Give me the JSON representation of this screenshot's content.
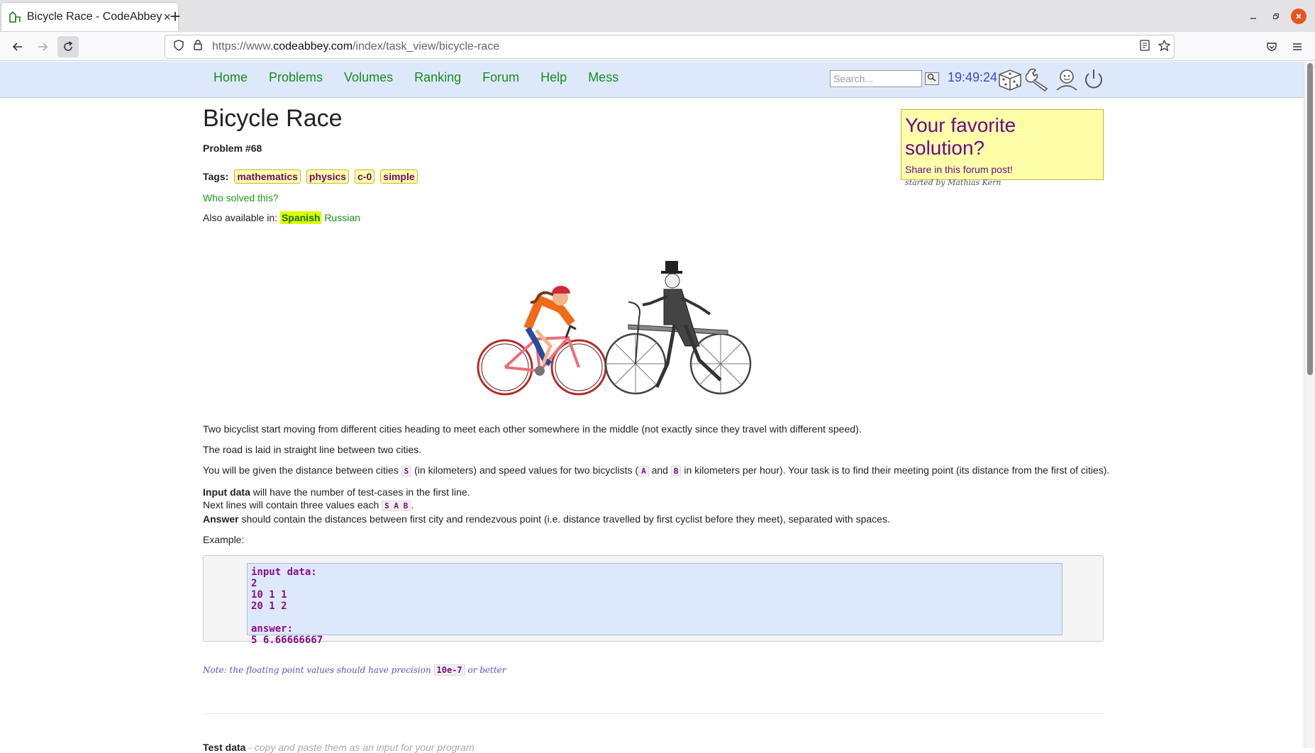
{
  "browser": {
    "tab_title": "Bicycle Race - CodeAbbey",
    "tab_close": "×",
    "new_tab": "+",
    "url_host_prefix": "https://www.",
    "url_host": "codeabbey.com",
    "url_path": "/index/task_view/bicycle-race"
  },
  "site": {
    "nav": [
      "Home",
      "Problems",
      "Volumes",
      "Ranking",
      "Forum",
      "Help",
      "Mess"
    ],
    "search_placeholder": "Search...",
    "clock": "19:49:24"
  },
  "problem": {
    "title": "Bicycle Race",
    "number": "Problem #68",
    "tags_label": "Tags:",
    "tags": [
      "mathematics",
      "physics",
      "c-0",
      "simple"
    ],
    "who_solved": "Who solved this?",
    "also_available": "Also available in:",
    "lang_spanish": "Spanish",
    "lang_russian": "Russian"
  },
  "favbox": {
    "heading": "Your favorite solution?",
    "link": "Share in this forum post!",
    "author": "started by Mathias Kern"
  },
  "statement": {
    "p1": "Two bicyclist start moving from different cities heading to meet each other somewhere in the middle (not exactly since they travel with different speed).",
    "p2": "The road is laid in straight line between two cities.",
    "p3a": "You will be given the distance between cities ",
    "p3_s": "S",
    "p3b": " (in kilometers) and speed values for two bicyclists (",
    "p3_a": "A",
    "p3c": " and ",
    "p3_b": "B",
    "p3d": " in kilometers per hour). Your task is to find their meeting point (its distance from the first of cities).",
    "input_bold": "Input data",
    "input_rest": " will have the number of test-cases in the first line.",
    "next_lines": "Next lines will contain three values each ",
    "next_code": "S A B",
    "next_end": ".",
    "answer_bold": "Answer",
    "answer_rest": " should contain the distances between first city and rendezvous point (i.e. distance travelled by first cyclist before they meet), separated with spaces.",
    "example_label": "Example:",
    "example_code": "input data:\n2\n10 1 1\n20 1 2\n\nanswer:\n5 6.66666667",
    "note_a": "Note: the floating point values should have precision ",
    "note_code": "10e-7",
    "note_b": " or better",
    "testdata_bold": "Test data",
    "testdata_rest": " - copy and paste them as an input for your program"
  }
}
